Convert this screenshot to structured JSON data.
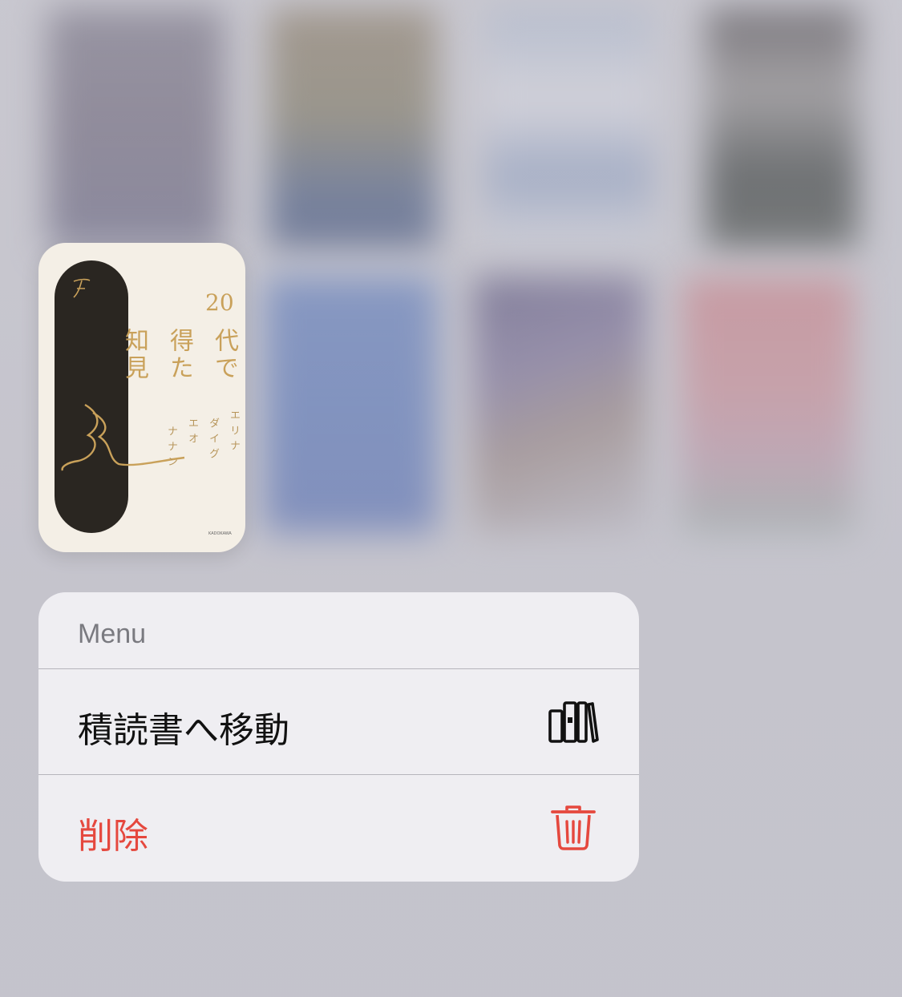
{
  "book": {
    "title_col1": "代で",
    "title_col2": "得た",
    "title_col3": "知見",
    "title_number": "20",
    "author_col1": "エリナ",
    "author_col2": "ダイグ",
    "author_col3": "エオ",
    "author_col4": "ナナン",
    "publisher": "KADOKAWA"
  },
  "menu": {
    "header": "Menu",
    "items": [
      {
        "label": "積読書へ移動",
        "icon": "books-icon",
        "style": "default"
      },
      {
        "label": "削除",
        "icon": "trash-icon",
        "style": "destructive"
      }
    ]
  },
  "colors": {
    "destructive": "#e5483e",
    "menu_background": "#efeef2",
    "backdrop": "#c6c5cd"
  }
}
